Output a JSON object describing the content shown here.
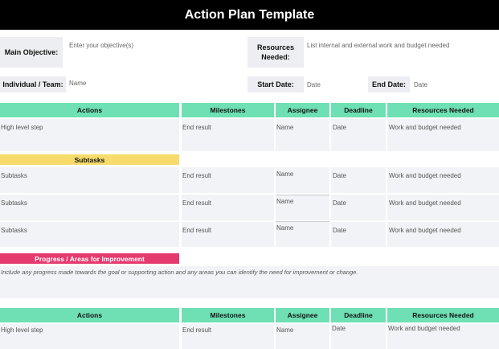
{
  "title": "Action Plan Template",
  "fields": {
    "main_objective": {
      "label": "Main Objective:",
      "placeholder": "Enter your objective(s)"
    },
    "resources_needed": {
      "label": "Resources Needed:",
      "placeholder": "List internal and external work and budget needed"
    },
    "individual_team": {
      "label": "Individual / Team:",
      "placeholder": "Name"
    },
    "start_date": {
      "label": "Start Date:",
      "placeholder": "Date"
    },
    "end_date": {
      "label": "End Date:",
      "placeholder": "Date"
    }
  },
  "columns": [
    "Actions",
    "Milestones",
    "Assignee",
    "Deadline",
    "Resources Needed"
  ],
  "main_row": [
    "High level step",
    "End result",
    "Name",
    "Date",
    "Work and budget needed"
  ],
  "subtasks_label": "Subtasks",
  "subtask_rows": [
    [
      "Subtasks",
      "End result",
      "Name",
      "Date",
      "Work and budget needed"
    ],
    [
      "Subtasks",
      "End result",
      "Name",
      "Date",
      "Work and budget needed"
    ],
    [
      "Subtasks",
      "End result",
      "Name",
      "Date",
      "Work and budget needed"
    ]
  ],
  "progress": {
    "label": "Progress / Areas for Improvement",
    "text": "Include any progress made towards the goal or supporting action and any areas you can identify the need for improvement or change."
  },
  "second_table": {
    "columns": [
      "Actions",
      "Milestones",
      "Assignee",
      "Deadline",
      "Resources Needed"
    ],
    "row": [
      "High level step",
      "End result",
      "Name",
      "Date",
      "Work and budget needed"
    ]
  },
  "colors": {
    "header": "#6ee0b4",
    "subtasks": "#f7dc6b",
    "progress": "#e53a6e",
    "title_bar": "#000000"
  }
}
